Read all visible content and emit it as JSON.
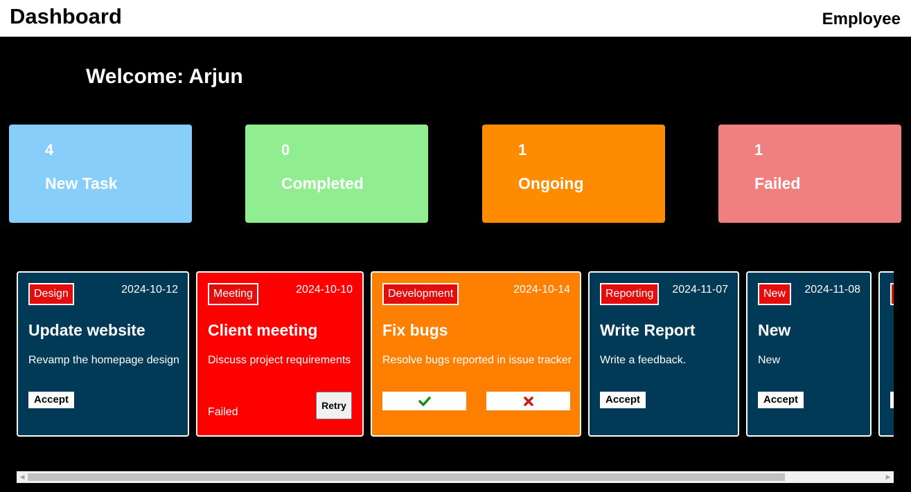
{
  "header": {
    "title": "Dashboard",
    "role": "Employee"
  },
  "welcome": "Welcome: Arjun",
  "stats": [
    {
      "count": "4",
      "label": "New Task",
      "color": "#87cefa"
    },
    {
      "count": "0",
      "label": "Completed",
      "color": "#90ee90"
    },
    {
      "count": "1",
      "label": "Ongoing",
      "color": "#ff8c00"
    },
    {
      "count": "1",
      "label": "Failed",
      "color": "#f08080"
    }
  ],
  "tasks": [
    {
      "category": "Design",
      "date": "2024-10-12",
      "title": "Update website",
      "description": "Revamp the homepage design",
      "action": "Accept",
      "color": "#003a57"
    },
    {
      "category": "Meeting",
      "date": "2024-10-10",
      "title": "Client meeting",
      "description": "Discuss project requirements",
      "status": "Failed",
      "action": "Retry",
      "color": "#ff0000"
    },
    {
      "category": "Development",
      "date": "2024-10-14",
      "title": "Fix bugs",
      "description": "Resolve bugs reported in issue tracker",
      "color": "#ff7f00",
      "complete_icon": "check-icon",
      "fail_icon": "cross-icon"
    },
    {
      "category": "Reporting",
      "date": "2024-11-07",
      "title": "Write Report",
      "description": "Write a feedback.",
      "action": "Accept",
      "color": "#003a57"
    },
    {
      "category": "New",
      "date": "2024-11-08",
      "title": "New",
      "description": "New",
      "action": "Accept",
      "color": "#003a57"
    }
  ]
}
